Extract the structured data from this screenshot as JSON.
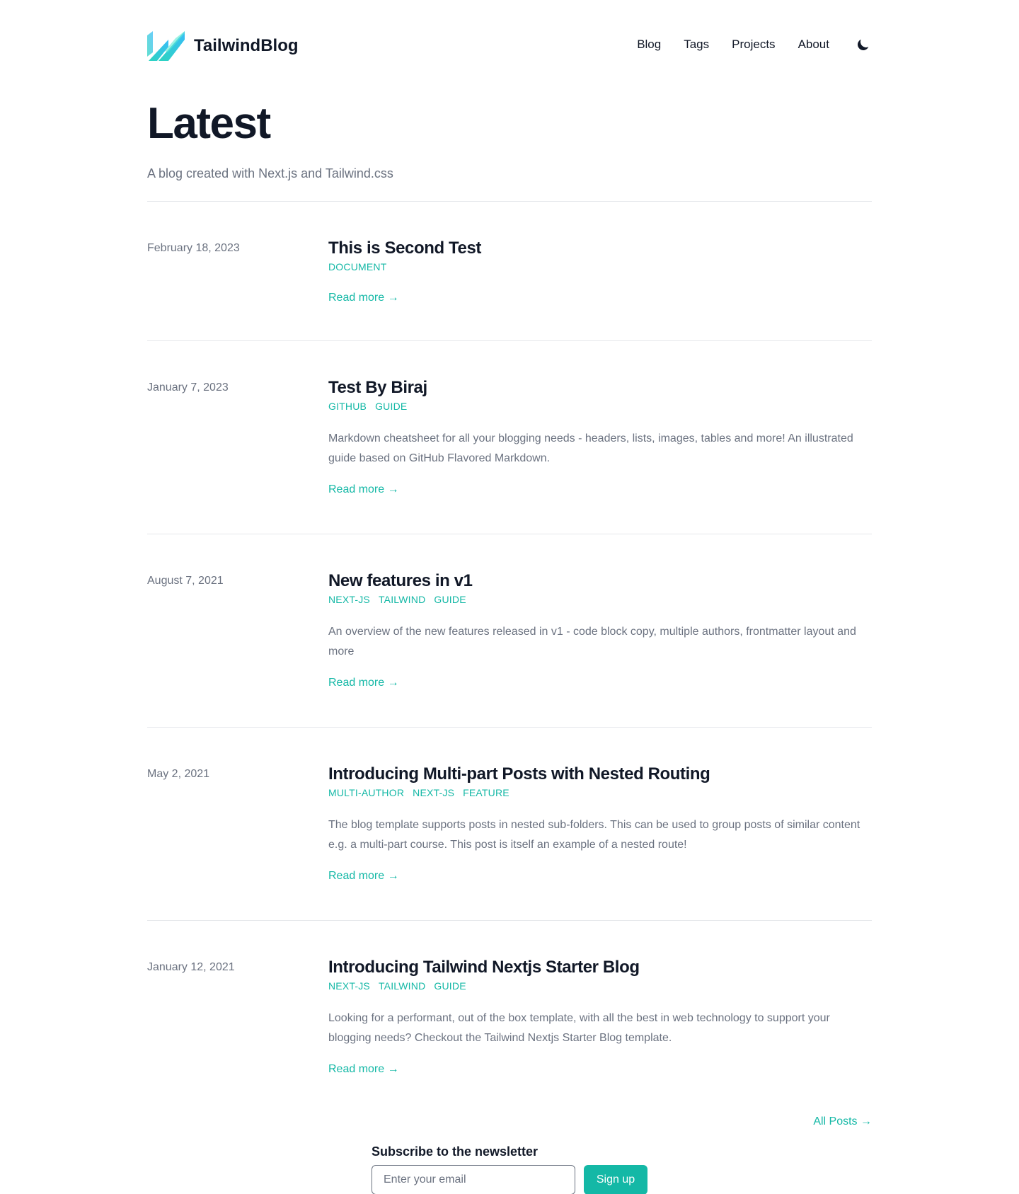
{
  "header": {
    "site_title": "TailwindBlog",
    "nav": [
      {
        "label": "Blog"
      },
      {
        "label": "Tags"
      },
      {
        "label": "Projects"
      },
      {
        "label": "About"
      }
    ],
    "theme_icon": "moon-icon"
  },
  "hero": {
    "title": "Latest",
    "subtitle": "A blog created with Next.js and Tailwind.css"
  },
  "posts": [
    {
      "date": "February 18, 2023",
      "title": "This is Second Test",
      "tags": [
        "DOCUMENT"
      ],
      "summary": "",
      "read_more": "Read more →"
    },
    {
      "date": "January 7, 2023",
      "title": "Test By Biraj",
      "tags": [
        "GITHUB",
        "GUIDE"
      ],
      "summary": "Markdown cheatsheet for all your blogging needs - headers, lists, images, tables and more! An illustrated guide based on GitHub Flavored Markdown.",
      "read_more": "Read more →"
    },
    {
      "date": "August 7, 2021",
      "title": "New features in v1",
      "tags": [
        "NEXT-JS",
        "TAILWIND",
        "GUIDE"
      ],
      "summary": "An overview of the new features released in v1 - code block copy, multiple authors, frontmatter layout and more",
      "read_more": "Read more →"
    },
    {
      "date": "May 2, 2021",
      "title": "Introducing Multi-part Posts with Nested Routing",
      "tags": [
        "MULTI-AUTHOR",
        "NEXT-JS",
        "FEATURE"
      ],
      "summary": "The blog template supports posts in nested sub-folders. This can be used to group posts of similar content e.g. a multi-part course. This post is itself an example of a nested route!",
      "read_more": "Read more →"
    },
    {
      "date": "January 12, 2021",
      "title": "Introducing Tailwind Nextjs Starter Blog",
      "tags": [
        "NEXT-JS",
        "TAILWIND",
        "GUIDE"
      ],
      "summary": "Looking for a performant, out of the box template, with all the best in web technology to support your blogging needs? Checkout the Tailwind Nextjs Starter Blog template.",
      "read_more": "Read more →"
    }
  ],
  "all_posts": "All Posts →",
  "newsletter": {
    "title": "Subscribe to the newsletter",
    "email_placeholder": "Enter your email",
    "email_value": "",
    "button_label": "Sign up"
  },
  "colors": {
    "accent": "#14b8a6",
    "text": "#111827",
    "muted": "#6b7280",
    "divider": "#e5e7eb"
  }
}
